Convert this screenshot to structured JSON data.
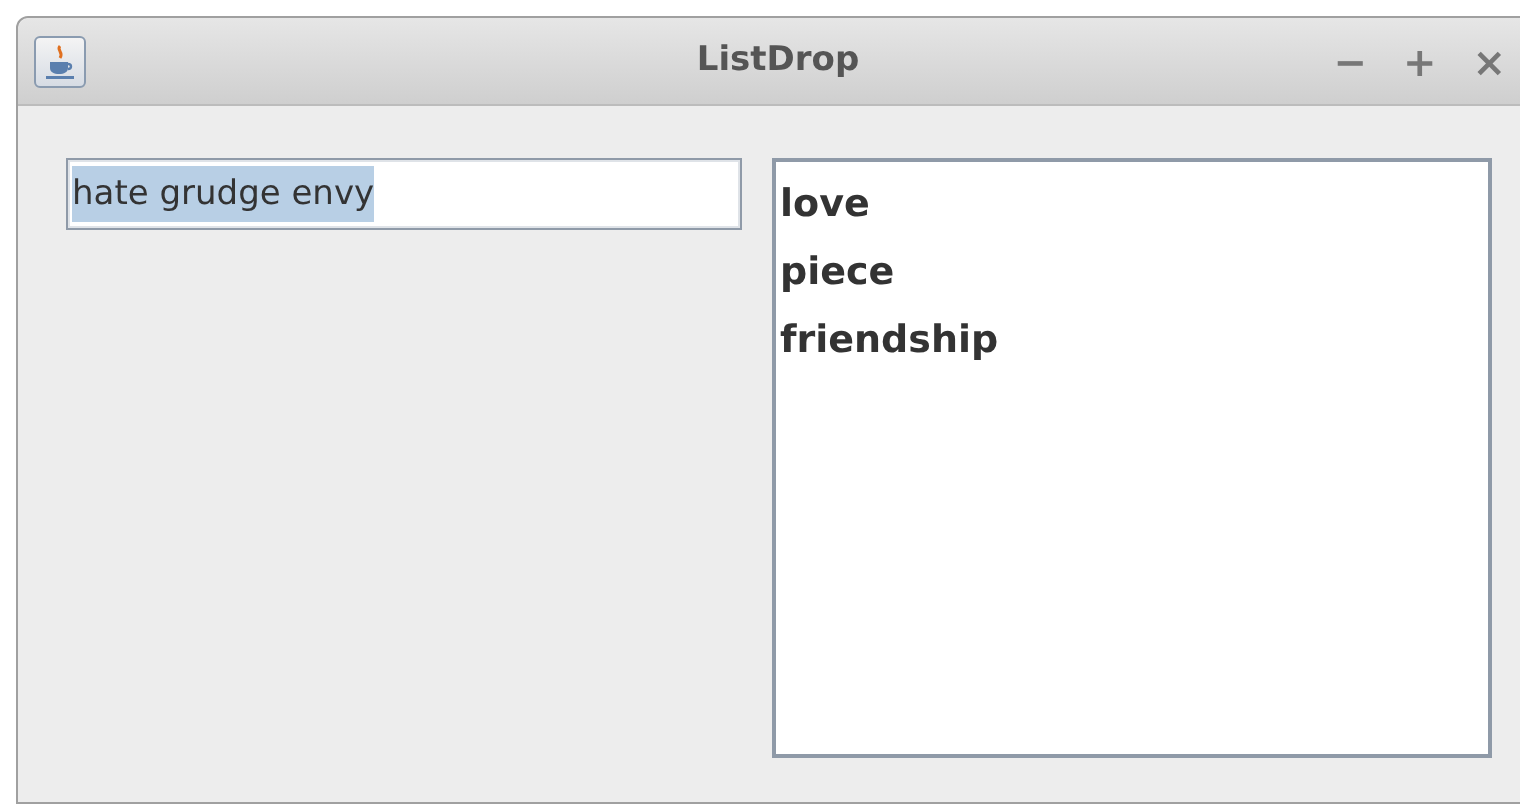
{
  "window": {
    "title": "ListDrop",
    "controls": [
      "−",
      "+",
      "×"
    ]
  },
  "text_field": {
    "value": "hate grudge envy",
    "text_selected": true
  },
  "list": {
    "items": [
      {
        "label": "love"
      },
      {
        "label": "piece"
      },
      {
        "label": "friendship"
      }
    ]
  }
}
